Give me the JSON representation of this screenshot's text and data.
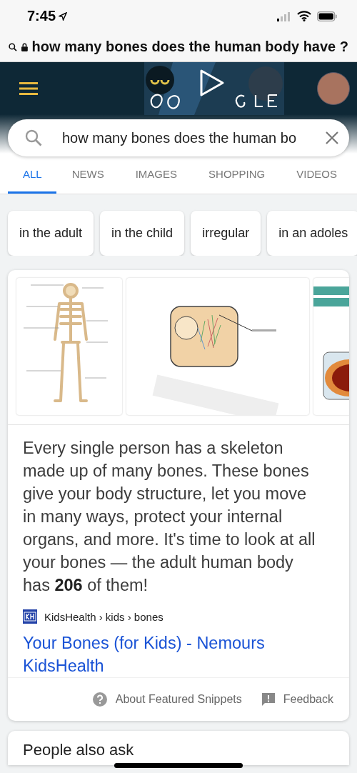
{
  "status_bar": {
    "time": "7:45"
  },
  "address_bar": {
    "text": "how many bones does the human body have ?"
  },
  "search": {
    "value": "how many bones does the human bo"
  },
  "tabs": [
    {
      "label": "ALL",
      "selected": true
    },
    {
      "label": "NEWS",
      "selected": false
    },
    {
      "label": "IMAGES",
      "selected": false
    },
    {
      "label": "SHOPPING",
      "selected": false
    },
    {
      "label": "VIDEOS",
      "selected": false
    }
  ],
  "chips": [
    "in the adult",
    "in the child",
    "irregular",
    "in an adoles"
  ],
  "featured_snippet": {
    "images": [
      {
        "kind": "skeleton"
      },
      {
        "kind": "periosteum"
      },
      {
        "kind": "cross-section"
      }
    ],
    "text": "Every single person has a skeleton made up of many bones. These bones give your body structure, let you move in many ways, protect your internal organs, and more. It's time to look at all your bones — the adult human body has **206** of them!",
    "source": "KidsHealth › kids › bones",
    "title": "Your Bones (for Kids) - Nemours KidsHealth",
    "footer": [
      {
        "kind": "help",
        "label": "About Featured Snippets"
      },
      {
        "kind": "feedback",
        "label": "Feedback"
      }
    ]
  },
  "people_also_ask": {
    "heading": "People also ask"
  }
}
